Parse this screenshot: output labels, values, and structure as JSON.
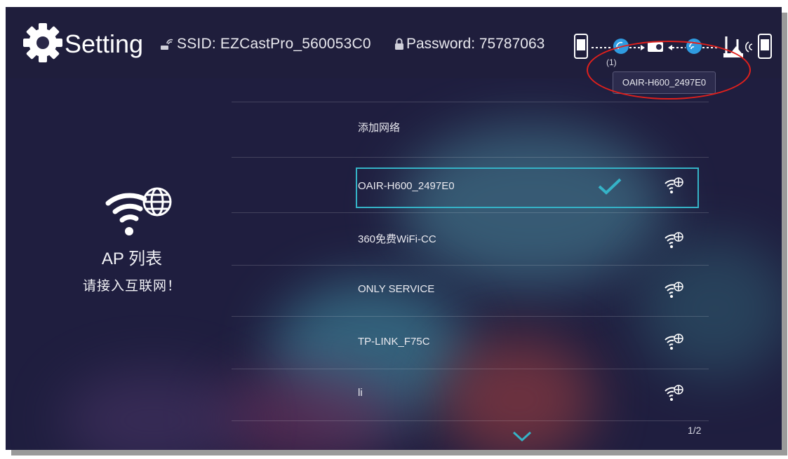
{
  "header": {
    "title": "Setting",
    "ssid_text": "SSID: EZCastPro_560053C0",
    "password_text": "Password: 75787063",
    "connected_count": "(1)",
    "connected_tooltip": "OAIR-H600_2497E0"
  },
  "left_panel": {
    "title": "AP 列表",
    "subtitle": "请接入互联网！"
  },
  "list": {
    "add_network": "添加网络",
    "networks": [
      {
        "name": "OAIR-H600_2497E0",
        "selected": true
      },
      {
        "name": "360免费WiFi-CC",
        "selected": false
      },
      {
        "name": "ONLY SERVICE",
        "selected": false
      },
      {
        "name": "TP-LINK_F75C",
        "selected": false
      },
      {
        "name": "li",
        "selected": false
      }
    ],
    "page": "1/2"
  },
  "colors": {
    "accent": "#35b3c7",
    "annotation": "#e0201c",
    "background": "#1f1e3f"
  }
}
